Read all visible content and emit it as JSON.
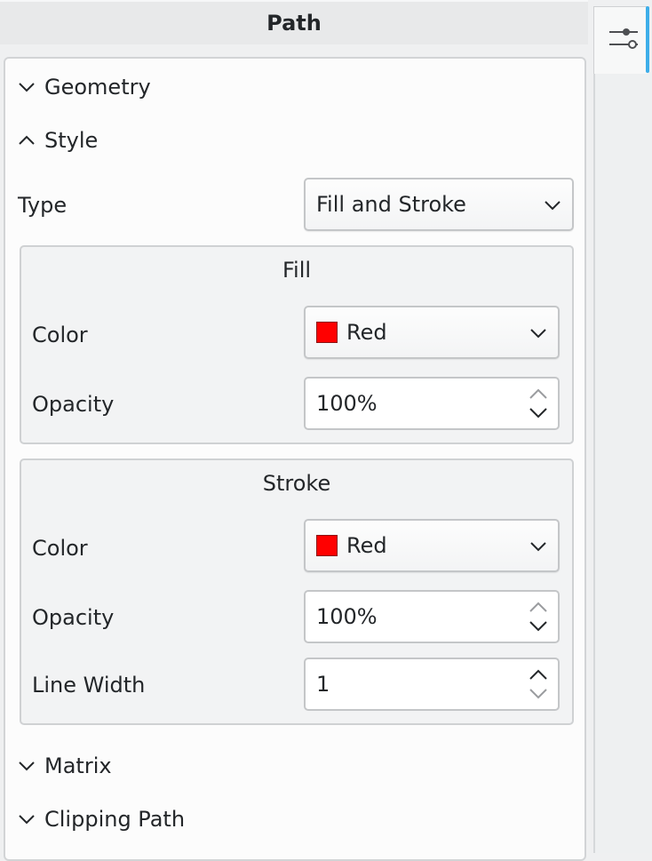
{
  "header": {
    "title": "Path"
  },
  "sidebar": {
    "icon": "sliders-icon"
  },
  "sections": {
    "geometry": {
      "label": "Geometry",
      "expanded": false
    },
    "style": {
      "label": "Style",
      "expanded": true
    },
    "matrix": {
      "label": "Matrix",
      "expanded": false
    },
    "clipping": {
      "label": "Clipping Path",
      "expanded": false
    }
  },
  "style": {
    "type_label": "Type",
    "type_value": "Fill and Stroke",
    "fill": {
      "title": "Fill",
      "color_label": "Color",
      "color_value": "Red",
      "color_hex": "#ff0000",
      "opacity_label": "Opacity",
      "opacity_value": "100%"
    },
    "stroke": {
      "title": "Stroke",
      "color_label": "Color",
      "color_value": "Red",
      "color_hex": "#ff0000",
      "opacity_label": "Opacity",
      "opacity_value": "100%",
      "width_label": "Line Width",
      "width_value": "1"
    }
  },
  "colors": {
    "accent": "#3daee9",
    "panel_bg": "#fcfcfc",
    "window_bg": "#eff0f1"
  }
}
